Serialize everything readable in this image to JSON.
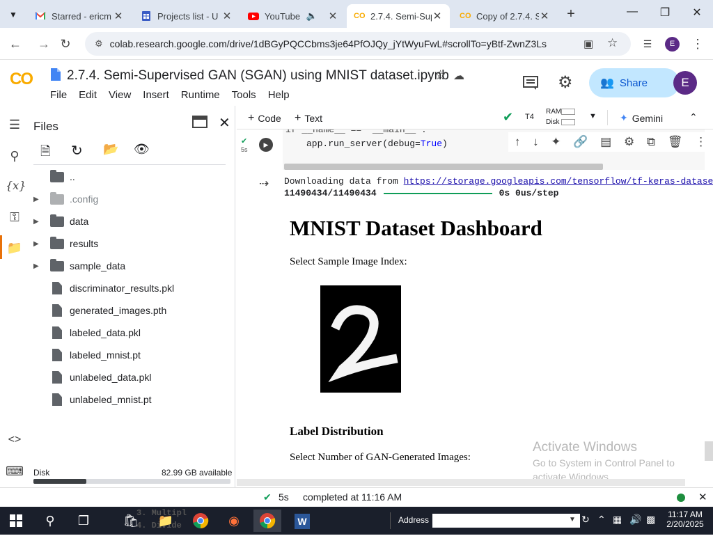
{
  "browser": {
    "tabs": [
      {
        "title": "Starred - ericm",
        "icon": "gmail-icon"
      },
      {
        "title": "Projects list - U",
        "icon": "sheets-icon"
      },
      {
        "title": "YouTube",
        "icon": "youtube-icon"
      },
      {
        "title": "2.7.4. Semi-Sup",
        "icon": "colab-icon",
        "active": true
      },
      {
        "title": "Copy of 2.7.4. S",
        "icon": "colab-icon"
      }
    ],
    "new_tab": "+",
    "url": "colab.research.google.com/drive/1dBGyPQCCbms3je64PfOJQy_jYtWyuFwL#scrollTo=yBtf-ZwnZ3Ls",
    "profile_initial": "E"
  },
  "colab": {
    "logo_text": "CO",
    "notebook_title": "2.7.4. Semi-Supervised GAN (SGAN) using MNIST dataset.ipynb",
    "menu": [
      "File",
      "Edit",
      "View",
      "Insert",
      "Runtime",
      "Tools",
      "Help"
    ],
    "share_label": "Share",
    "avatar_initial": "E",
    "toolbar": {
      "code_label": "Code",
      "text_label": "Text",
      "runtime_type": "T4",
      "ram_label": "RAM",
      "disk_label": "Disk",
      "gemini_label": "Gemini"
    }
  },
  "files_panel": {
    "title": "Files",
    "items": [
      {
        "name": "..",
        "type": "folder-up"
      },
      {
        "name": ".config",
        "type": "folder",
        "dim": true
      },
      {
        "name": "data",
        "type": "folder"
      },
      {
        "name": "results",
        "type": "folder"
      },
      {
        "name": "sample_data",
        "type": "folder"
      },
      {
        "name": "discriminator_results.pkl",
        "type": "file"
      },
      {
        "name": "generated_images.pth",
        "type": "file"
      },
      {
        "name": "labeled_data.pkl",
        "type": "file"
      },
      {
        "name": "labeled_mnist.pt",
        "type": "file"
      },
      {
        "name": "unlabeled_data.pkl",
        "type": "file"
      },
      {
        "name": "unlabeled_mnist.pt",
        "type": "file"
      }
    ],
    "disk_label": "Disk",
    "disk_available": "82.99 GB available",
    "disk_used_fraction": 0.27
  },
  "cell": {
    "exec_time": "5s",
    "code_line_1": "if __name__ == '__main__':",
    "code_line_2_prefix": "app.run_server(debug=",
    "code_line_2_kw": "True",
    "code_line_2_suffix": ")",
    "output_download_prefix": "Downloading data from ",
    "output_download_link": "https://storage.googleapis.com/tensorflow/tf-keras-datase",
    "output_progress_count": "11490434/11490434",
    "output_progress_suffix": "0s 0us/step"
  },
  "dashboard": {
    "title": "MNIST Dataset Dashboard",
    "select_label": "Select Sample Image Index:",
    "label_distribution": "Label Distribution",
    "gan_label": "Select Number of GAN-Generated Images:"
  },
  "watermark": {
    "line1": "Activate Windows",
    "line2": "Go to System in Control Panel to",
    "line3": "activate Windows."
  },
  "statusbar": {
    "exec_time": "5s",
    "completed": "completed at 11:16 AM"
  },
  "taskbar": {
    "address_label": "Address",
    "time": "11:17 AM",
    "date": "2/20/2025",
    "behind_text_1": "3. Multipl",
    "behind_text_2": "4. Divide"
  }
}
